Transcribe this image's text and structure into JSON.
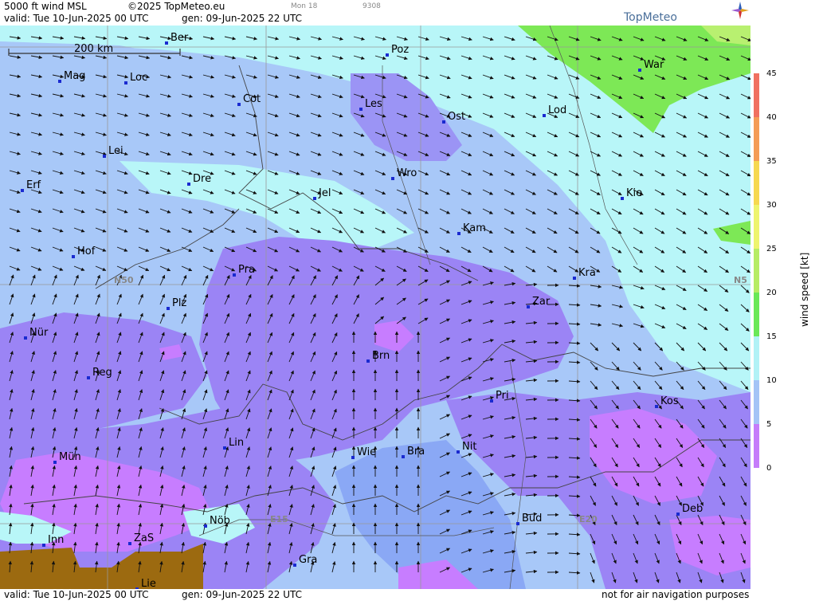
{
  "header": {
    "product": "5000 ft wind MSL",
    "copyright": "©2025 TopMeteo.eu",
    "model": "Mon 18",
    "code": "9308",
    "valid": "valid:  Tue  10-Jun-2025  00 UTC",
    "gen": "gen: 09-Jun-2025 22 UTC",
    "brand": "TopMeteo"
  },
  "footer": {
    "valid": "valid:  Tue  10-Jun-2025  00 UTC",
    "gen": "gen: 09-Jun-2025 22 UTC",
    "disclaimer": "not for air navigation purposes"
  },
  "map": {
    "scale_label": "200 km",
    "grid_labels": [
      "N50",
      "N5",
      "E15",
      "E20"
    ],
    "cities": [
      {
        "name": "Ber"
      },
      {
        "name": "Poz"
      },
      {
        "name": "Mag"
      },
      {
        "name": "Loc"
      },
      {
        "name": "War"
      },
      {
        "name": "Cot"
      },
      {
        "name": "Les"
      },
      {
        "name": "Lod"
      },
      {
        "name": "Ost"
      },
      {
        "name": "Lei"
      },
      {
        "name": "Wro"
      },
      {
        "name": "Erf"
      },
      {
        "name": "Dre"
      },
      {
        "name": "Jel"
      },
      {
        "name": "Kie"
      },
      {
        "name": "Kam"
      },
      {
        "name": "Hof"
      },
      {
        "name": "Pra"
      },
      {
        "name": "Kra"
      },
      {
        "name": "Zar"
      },
      {
        "name": "Plz"
      },
      {
        "name": "Nür"
      },
      {
        "name": "Brn"
      },
      {
        "name": "Reg"
      },
      {
        "name": "Pri"
      },
      {
        "name": "Kos"
      },
      {
        "name": "Lin"
      },
      {
        "name": "Nit"
      },
      {
        "name": "Wie"
      },
      {
        "name": "Bra"
      },
      {
        "name": "Mün"
      },
      {
        "name": "Deb"
      },
      {
        "name": "Nöb"
      },
      {
        "name": "Bud"
      },
      {
        "name": "Inn"
      },
      {
        "name": "ZaS"
      },
      {
        "name": "Gra"
      },
      {
        "name": "Lie"
      }
    ]
  },
  "legend": {
    "title": "wind  speed  [kt]",
    "ticks": [
      "45",
      "40",
      "35",
      "30",
      "25",
      "20",
      "15",
      "10",
      "5",
      "0"
    ],
    "colors": {
      "violet": "#c77dff",
      "purple": "#9b84f5",
      "blue_mid": "#8aa8f5",
      "blue_light": "#a8c8f8",
      "cyan_light": "#b8f6f8",
      "green_light": "#8ef060",
      "green": "#6ce04a",
      "yellow": "#f6f66a",
      "orange": "#f7b04a",
      "red": "#f46a5a",
      "brown": "#9c6a10",
      "city_dot": "#1a2ad0"
    }
  }
}
